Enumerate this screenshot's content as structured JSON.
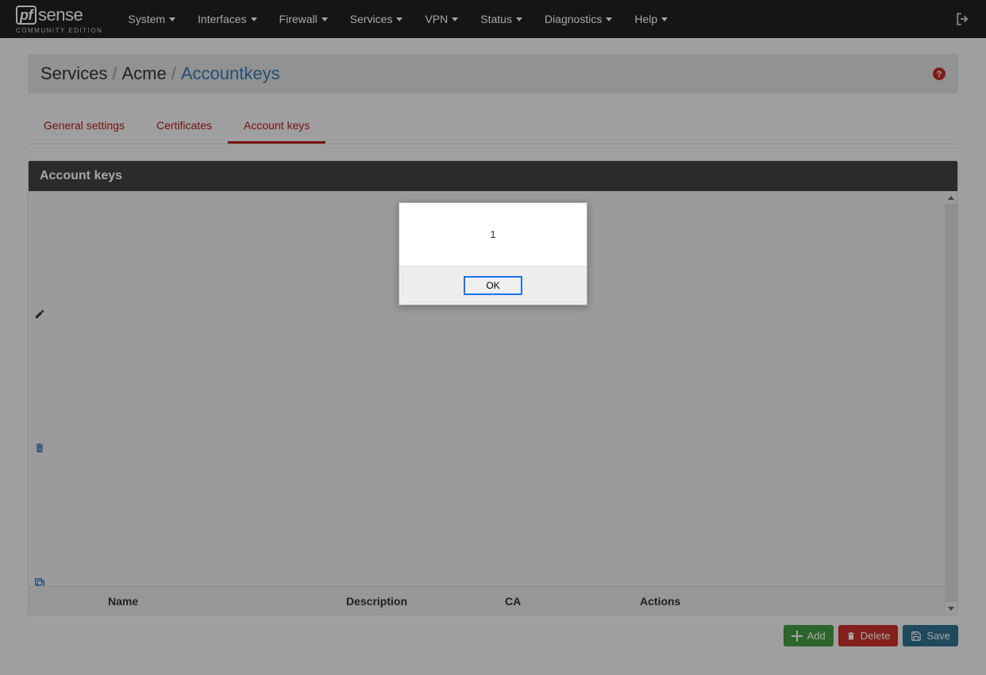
{
  "logo": {
    "pf": "pf",
    "sense": "sense",
    "subtitle": "COMMUNITY EDITION"
  },
  "nav": {
    "items": [
      "System",
      "Interfaces",
      "Firewall",
      "Services",
      "VPN",
      "Status",
      "Diagnostics",
      "Help"
    ]
  },
  "breadcrumb": {
    "items": [
      "Services",
      "Acme",
      "Accountkeys"
    ],
    "sep": "/"
  },
  "tabs": {
    "items": [
      "General settings",
      "Certificates",
      "Account keys"
    ],
    "active": 2
  },
  "panel": {
    "title": "Account keys",
    "columns": [
      "Name",
      "Description",
      "CA",
      "Actions"
    ]
  },
  "actions": {
    "add": "Add",
    "delete": "Delete",
    "save": "Save"
  },
  "dialog": {
    "message": "1",
    "ok": "OK"
  }
}
